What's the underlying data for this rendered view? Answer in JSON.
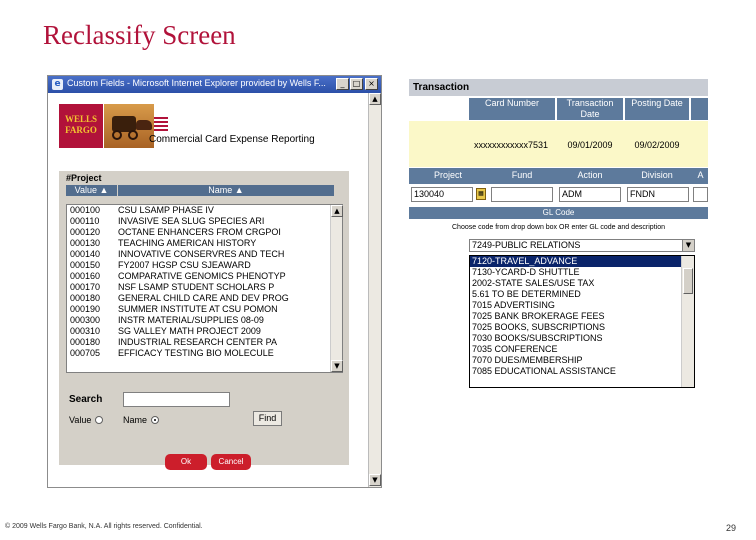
{
  "slide": {
    "title": "Reclassify Screen",
    "footer": "© 2009 Wells Fargo Bank, N.A. All rights reserved.  Confidential.",
    "page_number": "29"
  },
  "popup": {
    "window_title": "Custom Fields - Microsoft Internet Explorer provided by Wells F...",
    "logo_line1": "WELLS",
    "logo_line2": "FARGO",
    "app_name": "Commercial Card Expense Reporting",
    "panel_title": "#Project",
    "col_value": "Value ▲",
    "col_name": "Name ▲",
    "rows": [
      {
        "value": "000100",
        "name": "CSU LSAMP PHASE IV"
      },
      {
        "value": "000110",
        "name": "INVASIVE SEA SLUG SPECIES ARI"
      },
      {
        "value": "000120",
        "name": "OCTANE ENHANCERS FROM CRGPOI"
      },
      {
        "value": "000130",
        "name": "TEACHING AMERICAN HISTORY"
      },
      {
        "value": "000140",
        "name": "INNOVATIVE CONSERVRES AND TECH"
      },
      {
        "value": "000150",
        "name": "FY2007 HGSP CSU SJEAWARD"
      },
      {
        "value": "000160",
        "name": "COMPARATIVE GENOMICS PHENOTYP"
      },
      {
        "value": "000170",
        "name": "NSF LSAMP STUDENT SCHOLARS P"
      },
      {
        "value": "000180",
        "name": "GENERAL CHILD CARE AND DEV PROG"
      },
      {
        "value": "000190",
        "name": "SUMMER INSTITUTE AT CSU POMON"
      },
      {
        "value": "000300",
        "name": "INSTR MATERIAL/SUPPLIES 08-09"
      },
      {
        "value": "000310",
        "name": "SG VALLEY MATH PROJECT 2009"
      },
      {
        "value": "000180",
        "name": "INDUSTRIAL RESEARCH CENTER PA"
      },
      {
        "value": "000705",
        "name": "EFFICACY TESTING BIO MOLECULE"
      }
    ],
    "search_label": "Search",
    "search_value": "",
    "radio_value_label": "Value",
    "radio_name_label": "Name",
    "find_label": "Find",
    "ok_label": "Ok",
    "cancel_label": "Cancel"
  },
  "transaction": {
    "title": "Transaction",
    "headers": [
      "Card Number",
      "Transaction Date",
      "Posting Date"
    ],
    "card_number": "xxxxxxxxxxxx7531",
    "transaction_date": "09/01/2009",
    "posting_date": "09/02/2009",
    "field_headers": [
      "Project",
      "Fund",
      "Action",
      "Division",
      "A"
    ],
    "project_value": "130040",
    "fund_value": "",
    "action_value": "ADM",
    "division_value": "FNDN",
    "gl_header": "GL Code",
    "gl_note": "Choose code from drop down box OR enter GL code and description",
    "selected_gl": "7249-PUBLIC RELATIONS",
    "gl_options": [
      "7120-TRAVEL_ADVANCE",
      "7130-YCARD-D SHUTTLE",
      "2002-STATE SALES/USE TAX",
      "5.61 TO BE DETERMINED",
      "7015 ADVERTISING",
      "7025 BANK BROKERAGE FEES",
      "7025 BOOKS, SUBSCRIPTIONS",
      "7030 BOOKS/SUBSCRIPTIONS",
      "7035 CONFERENCE",
      "7070 DUES/MEMBERSHIP",
      "7085 EDUCATIONAL ASSISTANCE"
    ]
  }
}
